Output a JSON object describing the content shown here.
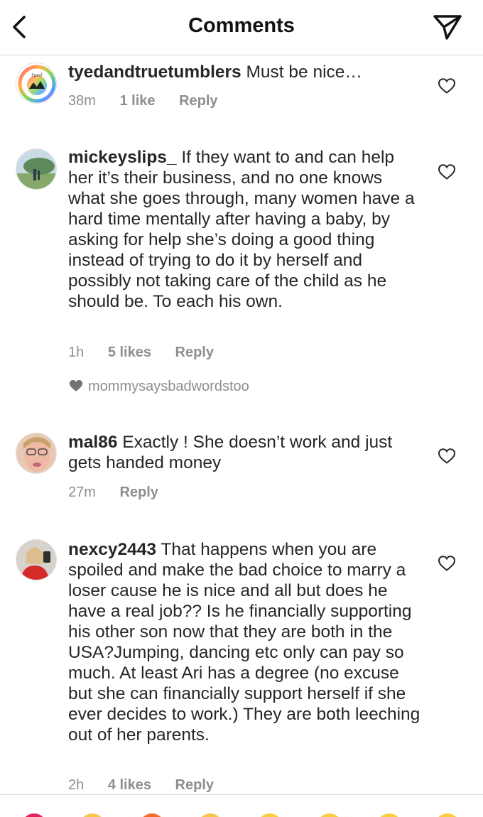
{
  "header": {
    "title": "Comments",
    "back_icon": "chevron-left-icon",
    "share_icon": "paper-plane-icon"
  },
  "comments": [
    {
      "username": "tyedandtruetumblers",
      "text": "Must be nice…",
      "time": "38m",
      "likes": "1 like",
      "reply": "Reply"
    },
    {
      "username": "mickeyslips_",
      "text": "If they want to and can help her it’s their business, and no one knows what she goes through, many women have a hard time mentally after having a baby, by asking for help she’s doing a good thing instead of trying to do it by herself and possibly not taking care of the child as he should be. To each his own.",
      "time": "1h",
      "likes": "5 likes",
      "reply": "Reply",
      "liked_by": "mommysaysbadwordstoo"
    },
    {
      "username": "mal86",
      "text": "Exactly ! She doesn’t work and just gets handed money",
      "time": "27m",
      "reply": "Reply"
    },
    {
      "username": "nexcy2443",
      "text": "That happens when you are spoiled and make the bad choice to marry a loser cause he is nice and all but does he have a real job?? Is he financially supporting his other son now that they are both in the USA?Jumping, dancing etc only can pay so much. At least Ari has a degree (no excuse but she can financially support herself if she ever decides to work.) They are both leeching out of her parents.",
      "time": "2h",
      "likes": "4 likes",
      "reply": "Reply"
    }
  ],
  "colors": {
    "text": "#262626",
    "meta": "#8e8e8e",
    "divider": "#dbdbdb"
  }
}
